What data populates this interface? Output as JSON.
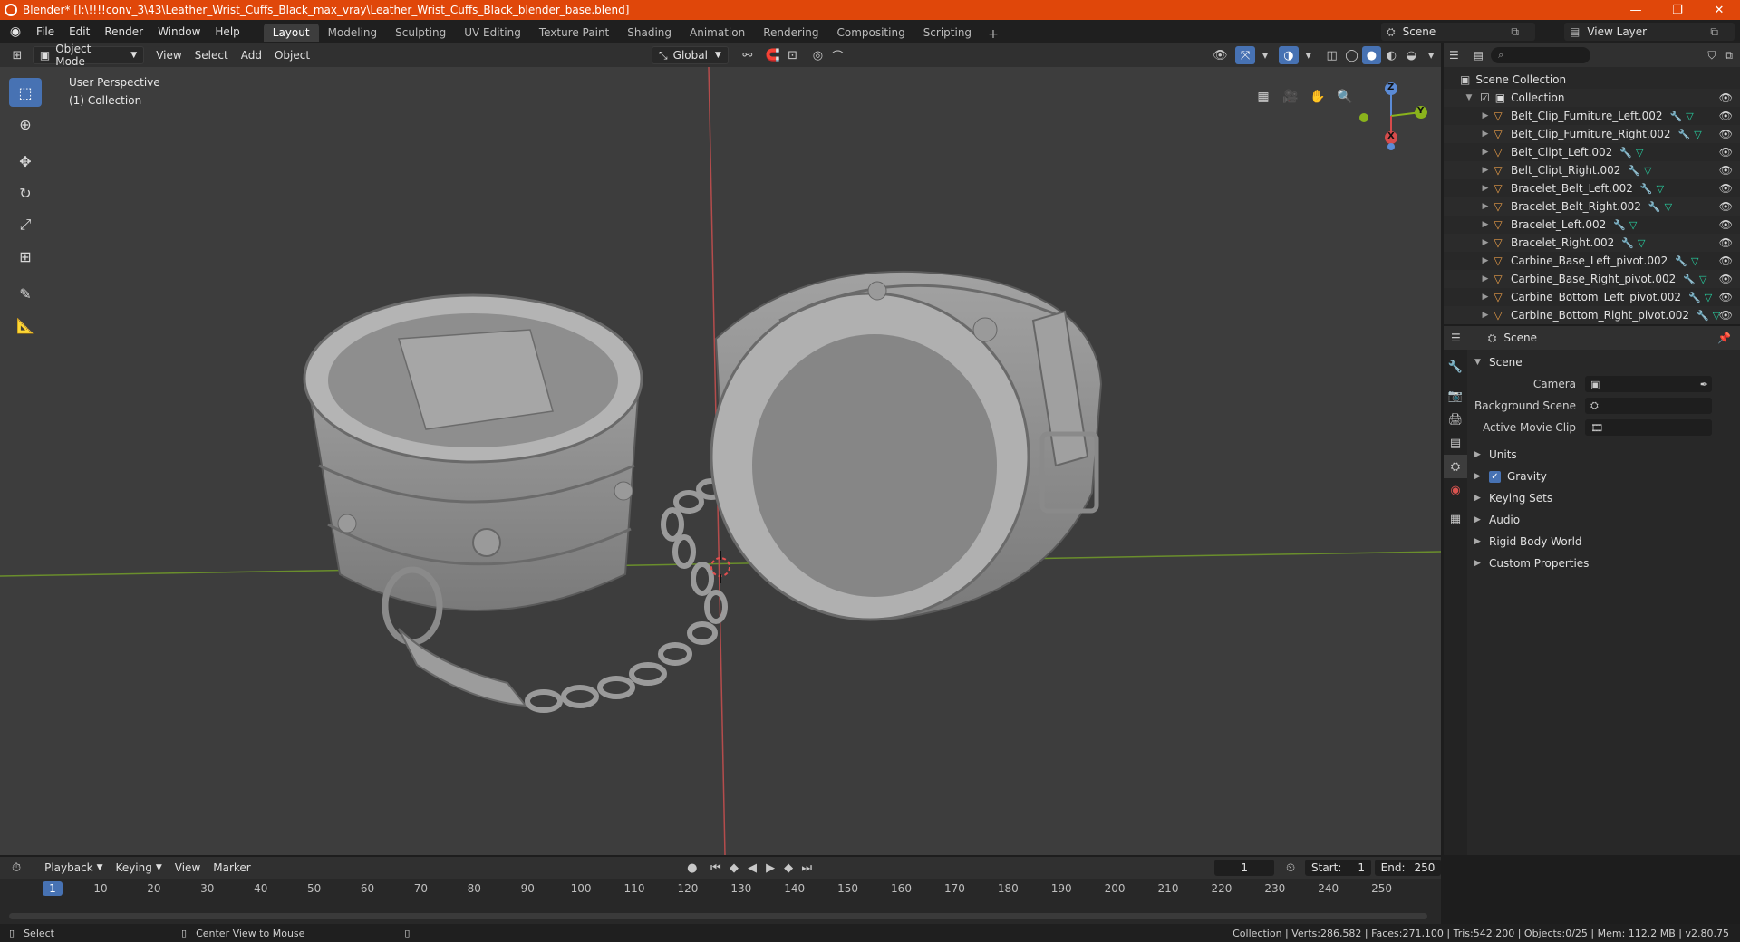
{
  "titlebar": {
    "title": "Blender* [I:\\!!!!conv_3\\43\\Leather_Wrist_Cuffs_Black_max_vray\\Leather_Wrist_Cuffs_Black_blender_base.blend]",
    "minimize": "—",
    "restore": "❐",
    "close": "✕"
  },
  "menubar": {
    "menus": [
      "File",
      "Edit",
      "Render",
      "Window",
      "Help"
    ],
    "workspaces": [
      "Layout",
      "Modeling",
      "Sculpting",
      "UV Editing",
      "Texture Paint",
      "Shading",
      "Animation",
      "Rendering",
      "Compositing",
      "Scripting"
    ],
    "active_workspace": "Layout",
    "scene": "Scene",
    "view_layer": "View Layer"
  },
  "viewport_header": {
    "mode": "Object Mode",
    "menus": [
      "View",
      "Select",
      "Add",
      "Object"
    ],
    "transform_orientation": "Global"
  },
  "viewport": {
    "perspective": "User Perspective",
    "collection": "(1) Collection",
    "axes": {
      "x": "X",
      "y": "Y",
      "z": "Z"
    }
  },
  "outliner": {
    "root": "Scene Collection",
    "collection": "Collection",
    "objects": [
      "Belt_Clip_Furniture_Left.002",
      "Belt_Clip_Furniture_Right.002",
      "Belt_Clipt_Left.002",
      "Belt_Clipt_Right.002",
      "Bracelet_Belt_Left.002",
      "Bracelet_Belt_Right.002",
      "Bracelet_Left.002",
      "Bracelet_Right.002",
      "Carbine_Base_Left_pivot.002",
      "Carbine_Base_Right_pivot.002",
      "Carbine_Bottom_Left_pivot.002",
      "Carbine_Bottom_Right_pivot.002"
    ]
  },
  "properties": {
    "context": "Scene",
    "panel": "Scene",
    "camera_label": "Camera",
    "background_scene_label": "Background Scene",
    "active_movie_clip_label": "Active Movie Clip",
    "subpanels": [
      "Units",
      "Gravity",
      "Keying Sets",
      "Audio",
      "Rigid Body World",
      "Custom Properties"
    ]
  },
  "timeline": {
    "menus": [
      "Playback",
      "Keying",
      "View",
      "Marker"
    ],
    "current_frame": "1",
    "start_label": "Start:",
    "start": "1",
    "end_label": "End:",
    "end": "250",
    "ticks": [
      "10",
      "20",
      "30",
      "40",
      "50",
      "60",
      "70",
      "80",
      "90",
      "100",
      "110",
      "120",
      "130",
      "140",
      "150",
      "160",
      "170",
      "180",
      "190",
      "200",
      "210",
      "220",
      "230",
      "240",
      "250"
    ]
  },
  "statusbar": {
    "select": "Select",
    "center_view": "Center View to Mouse",
    "stats": "Collection | Verts:286,582 | Faces:271,100 | Tris:542,200 | Objects:0/25 | Mem: 112.2 MB | v2.80.75"
  }
}
